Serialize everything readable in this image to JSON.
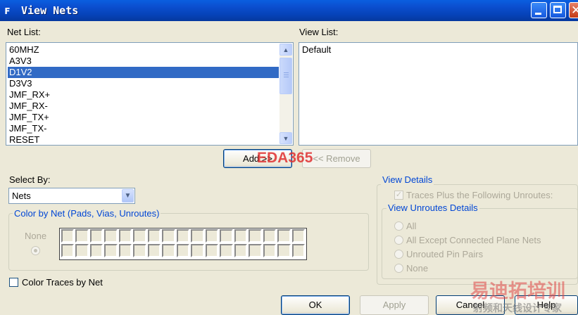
{
  "window": {
    "title": "View Nets",
    "icon_glyph": "ꜰ",
    "min_glyph": "",
    "close_glyph": "✕"
  },
  "net_list": {
    "label": "Net List:",
    "items": [
      "60MHZ",
      "A3V3",
      "D1V2",
      "D3V3",
      "JMF_RX+",
      "JMF_RX-",
      "JMF_TX+",
      "JMF_TX-",
      "RESET"
    ],
    "selected_index": 2,
    "scroll_up": "▲",
    "scroll_down": "▼"
  },
  "view_list": {
    "label": "View List:",
    "items": [
      "Default"
    ]
  },
  "buttons": {
    "add": "Add >>",
    "remove": "<< Remove",
    "ok": "OK",
    "apply": "Apply",
    "cancel": "Cancel",
    "help": "Help"
  },
  "select_by": {
    "label": "Select By:",
    "value": "Nets",
    "arrow": "▼"
  },
  "color_by_net": {
    "title": "Color by Net (Pads, Vias, Unroutes)",
    "none_label": "None",
    "swatch_rows": 2,
    "swatch_cols": 17
  },
  "color_traces": {
    "label": "Color Traces by Net",
    "checked": false
  },
  "view_details": {
    "title": "View Details",
    "traces_plus_label": "Traces Plus the Following Unroutes:",
    "traces_plus_checked": true,
    "check_glyph": "✓",
    "unroutes_title": "View Unroutes Details",
    "options": [
      "All",
      "All Except Connected Plane Nets",
      "Unrouted Pin Pairs",
      "None"
    ]
  },
  "watermarks": {
    "eda": "EDA365",
    "cn_brand": "易迪拓培训",
    "cn_sub": "射频和天线设计专家"
  },
  "colors": {
    "titlebar": "#0a5fe0",
    "selection": "#316ac5",
    "group_title": "#0046d5",
    "watermark_red": "#e03030"
  }
}
